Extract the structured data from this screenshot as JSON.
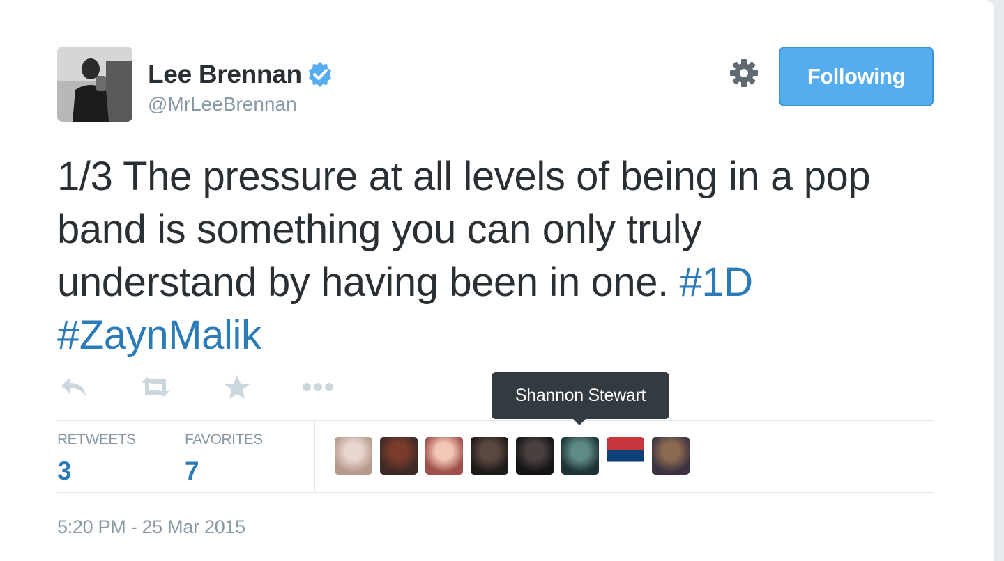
{
  "tweet": {
    "display_name": "Lee Brennan",
    "handle": "@MrLeeBrennan",
    "follow_button_label": "Following",
    "text_main": "1/3 The pressure at all levels of being in a pop band is something you can only truly understand by having been in one.",
    "hashtags": [
      "#1D",
      "#ZaynMalik"
    ],
    "timestamp": "5:20 PM - 25 Mar 2015"
  },
  "stats": {
    "retweets_label": "RETWEETS",
    "retweets_count": "3",
    "favorites_label": "FAVORITES",
    "favorites_count": "7"
  },
  "tooltip": {
    "text": "Shannon Stewart"
  },
  "icons": {
    "verified": "verified-badge-icon",
    "gear": "gear-icon",
    "reply": "reply-icon",
    "retweet": "retweet-icon",
    "favorite": "star-icon",
    "more": "more-icon"
  },
  "colors": {
    "accent": "#55acee",
    "link": "#2b7bb9",
    "muted": "#8899a6",
    "text": "#292f33",
    "action_icon": "#ccd6dd",
    "tooltip_bg": "#333b40"
  },
  "favoriters": [
    {
      "avatar": "favoriter-avatar-1",
      "colors": [
        "#e9d6cf",
        "#b79a8e"
      ]
    },
    {
      "avatar": "favoriter-avatar-2",
      "colors": [
        "#7a3b2b",
        "#3d2a26"
      ]
    },
    {
      "avatar": "favoriter-avatar-3",
      "colors": [
        "#f3c7b8",
        "#9e4f4a"
      ]
    },
    {
      "avatar": "favoriter-avatar-4",
      "colors": [
        "#5b4840",
        "#1f1a1a"
      ]
    },
    {
      "avatar": "favoriter-avatar-5",
      "colors": [
        "#4a4040",
        "#141414"
      ]
    },
    {
      "avatar": "favoriter-avatar-6",
      "colors": [
        "#5f8b86",
        "#1d3336"
      ]
    },
    {
      "avatar": "favoriter-avatar-7-serbian-flag",
      "colors": [
        "#c6363c",
        "#0c4076",
        "#ffffff"
      ]
    },
    {
      "avatar": "favoriter-avatar-8",
      "colors": [
        "#8c6a52",
        "#3c3340"
      ]
    }
  ]
}
